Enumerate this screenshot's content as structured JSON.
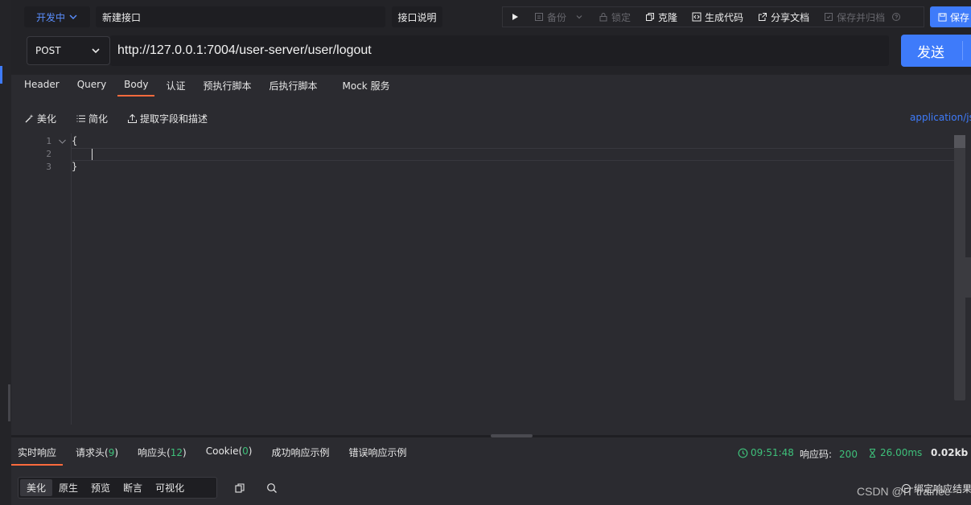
{
  "header": {
    "status_label": "开发中",
    "api_name": "新建接口",
    "desc_button": "接口说明",
    "toolbar": {
      "backup": "备份",
      "lock": "锁定",
      "clone": "克隆",
      "gen_code": "生成代码",
      "share_doc": "分享文档",
      "save_archive": "保存并归档"
    },
    "save_button": "保存"
  },
  "request": {
    "method": "POST",
    "url": "http://127.0.0.1:7004/user-server/user/logout",
    "send_button": "发送"
  },
  "tabs": [
    {
      "label": "Header"
    },
    {
      "label": "Query"
    },
    {
      "label": "Body"
    },
    {
      "label": "认证"
    },
    {
      "label": "预执行脚本"
    },
    {
      "label": "后执行脚本"
    },
    {
      "label": "Mock 服务"
    }
  ],
  "body_toolbar": {
    "beautify": "美化",
    "simplify": "简化",
    "extract": "提取字段和描述",
    "content_type": "application/jso"
  },
  "editor": {
    "lines": [
      {
        "num": "1",
        "text": "{"
      },
      {
        "num": "2",
        "text": ""
      },
      {
        "num": "3",
        "text": "}"
      }
    ]
  },
  "response": {
    "tabs": {
      "realtime": "实时响应",
      "req_headers": "请求头",
      "req_headers_count": "9",
      "resp_headers": "响应头",
      "resp_headers_count": "12",
      "cookie": "Cookie",
      "cookie_count": "0",
      "success_example": "成功响应示例",
      "error_example": "错误响应示例"
    },
    "time": "09:51:48",
    "status_label": "响应码:",
    "status_code": "200",
    "duration": "26.00ms",
    "size": "0.02kb",
    "view_tabs": [
      "美化",
      "原生",
      "预览",
      "断言",
      "可视化"
    ],
    "bind_result": "绑定响应结果"
  },
  "watermark": "CSDN @IT trainee",
  "colors": {
    "accent": "#3e7bfa",
    "active_tab": "#ff6a3d",
    "success": "#3ec07a"
  }
}
